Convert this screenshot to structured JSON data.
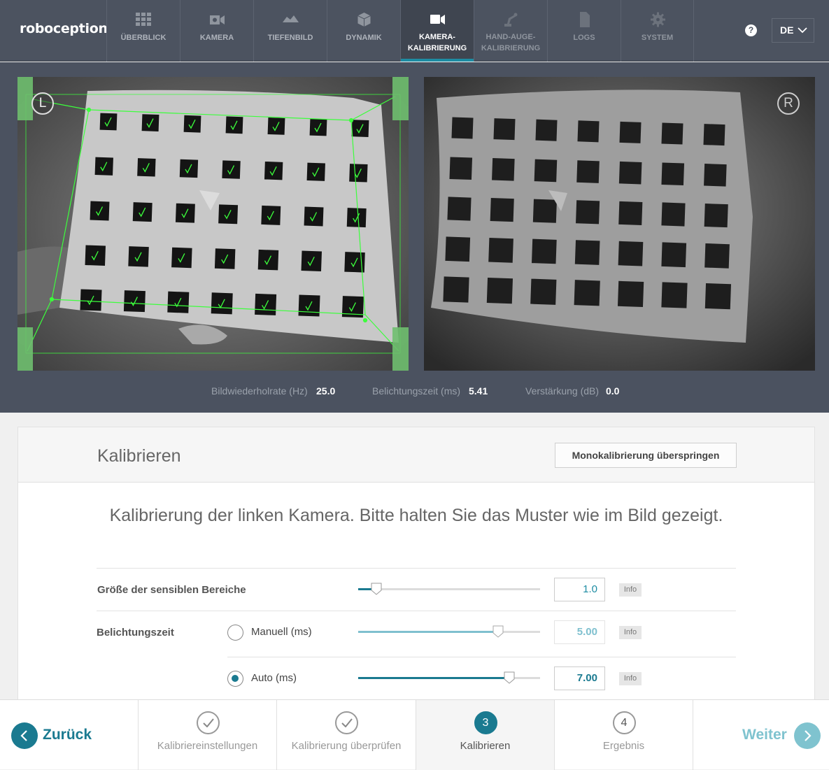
{
  "app": {
    "logo": "roboception"
  },
  "nav": [
    {
      "label": "ÜBERBLICK",
      "icon": "grid-icon"
    },
    {
      "label": "KAMERA",
      "icon": "camera-icon"
    },
    {
      "label": "TIEFENBILD",
      "icon": "depth-icon"
    },
    {
      "label": "DYNAMIK",
      "icon": "cube-icon"
    },
    {
      "label": "KAMERA-\nKALIBRIERUNG",
      "icon": "video-camera-icon",
      "active": true
    },
    {
      "label": "HAND-AUGE-\nKALIBRIERUNG",
      "icon": "robot-arm-icon"
    },
    {
      "label": "LOGS",
      "icon": "document-icon"
    },
    {
      "label": "SYSTEM",
      "icon": "gear-icon"
    }
  ],
  "header": {
    "help": "?",
    "language": "DE"
  },
  "cameras": {
    "left_label": "L",
    "right_label": "R"
  },
  "stats": {
    "framerate_label": "Bildwiederholrate (Hz)",
    "framerate": "25.0",
    "exposure_label": "Belichtungszeit (ms)",
    "exposure": "5.41",
    "gain_label": "Verstärkung (dB)",
    "gain": "0.0"
  },
  "panel": {
    "title": "Kalibrieren",
    "skip_button": "Monokalibrierung überspringen",
    "instruction": "Kalibrierung der linken Kamera. Bitte halten Sie das Muster wie im Bild gezeigt.",
    "sensitive_label": "Größe der sensiblen Bereiche",
    "sensitive_value": "1.0",
    "sensitive_fraction": 0.1,
    "exposure_label": "Belichtungszeit",
    "manual_label": "Manuell (ms)",
    "manual_value": "5.00",
    "manual_fraction": 0.77,
    "auto_label": "Auto (ms)",
    "auto_value": "7.00",
    "auto_fraction": 0.83,
    "info": "Info"
  },
  "footer": {
    "back": "Zurück",
    "next": "Weiter",
    "steps": [
      {
        "number": "",
        "label": "Kalibriereinstellungen",
        "done": true
      },
      {
        "number": "",
        "label": "Kalibrierung überprüfen",
        "done": true
      },
      {
        "number": "3",
        "label": "Kalibrieren",
        "current": true
      },
      {
        "number": "4",
        "label": "Ergebnis"
      }
    ]
  },
  "colors": {
    "accent": "#1a7a90",
    "accent_light": "#7fc3cf",
    "topbar": "#4c5360",
    "detect_green": "#3cff3c"
  }
}
